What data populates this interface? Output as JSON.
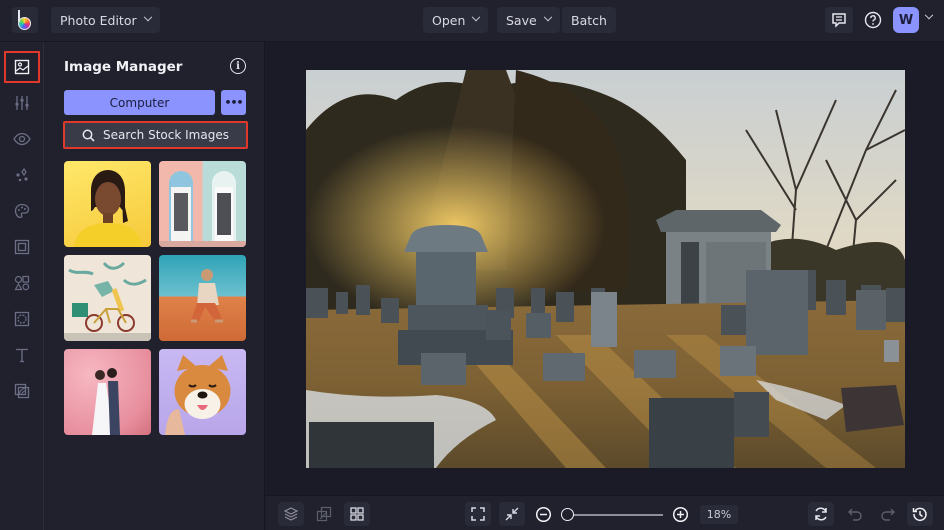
{
  "topbar": {
    "app_menu_label": "Photo Editor",
    "open_label": "Open",
    "save_label": "Save",
    "batch_label": "Batch",
    "avatar_initial": "W",
    "icons": [
      "logo-icon",
      "feedback-icon",
      "help-icon",
      "chevron-down-icon"
    ]
  },
  "rail": {
    "items": [
      {
        "name": "image-manager",
        "icon": "image-icon",
        "active": true
      },
      {
        "name": "adjustments",
        "icon": "sliders-icon",
        "active": false
      },
      {
        "name": "effects",
        "icon": "eye-icon",
        "active": false
      },
      {
        "name": "artsy",
        "icon": "sparkle-icon",
        "active": false
      },
      {
        "name": "touch-up",
        "icon": "palette-icon",
        "active": false
      },
      {
        "name": "frames",
        "icon": "frame-icon",
        "active": false
      },
      {
        "name": "graphics",
        "icon": "shapes-icon",
        "active": false
      },
      {
        "name": "overlays",
        "icon": "overlay-icon",
        "active": false
      },
      {
        "name": "text",
        "icon": "text-icon",
        "active": false
      },
      {
        "name": "textures",
        "icon": "texture-icon",
        "active": false
      }
    ]
  },
  "panel": {
    "title": "Image Manager",
    "computer_label": "Computer",
    "more_label": "•••",
    "search_stock_label": "Search Stock Images",
    "thumbnails": [
      {
        "subject": "woman on yellow background"
      },
      {
        "subject": "pastel doorways"
      },
      {
        "subject": "bicycle in front of mural"
      },
      {
        "subject": "man sitting on sand dune"
      },
      {
        "subject": "couple in cherry blossoms"
      },
      {
        "subject": "shiba inu dog on purple"
      }
    ]
  },
  "canvas": {
    "subject": "cemetery at sunset with gravestones and mausoleum"
  },
  "bottombar": {
    "zoom_percent": "18%",
    "zoom_fraction": 0.18
  },
  "colors": {
    "accent": "#8b93ff",
    "highlight": "#e0392b",
    "background": "#20212d",
    "canvas": "#1a1b26"
  }
}
